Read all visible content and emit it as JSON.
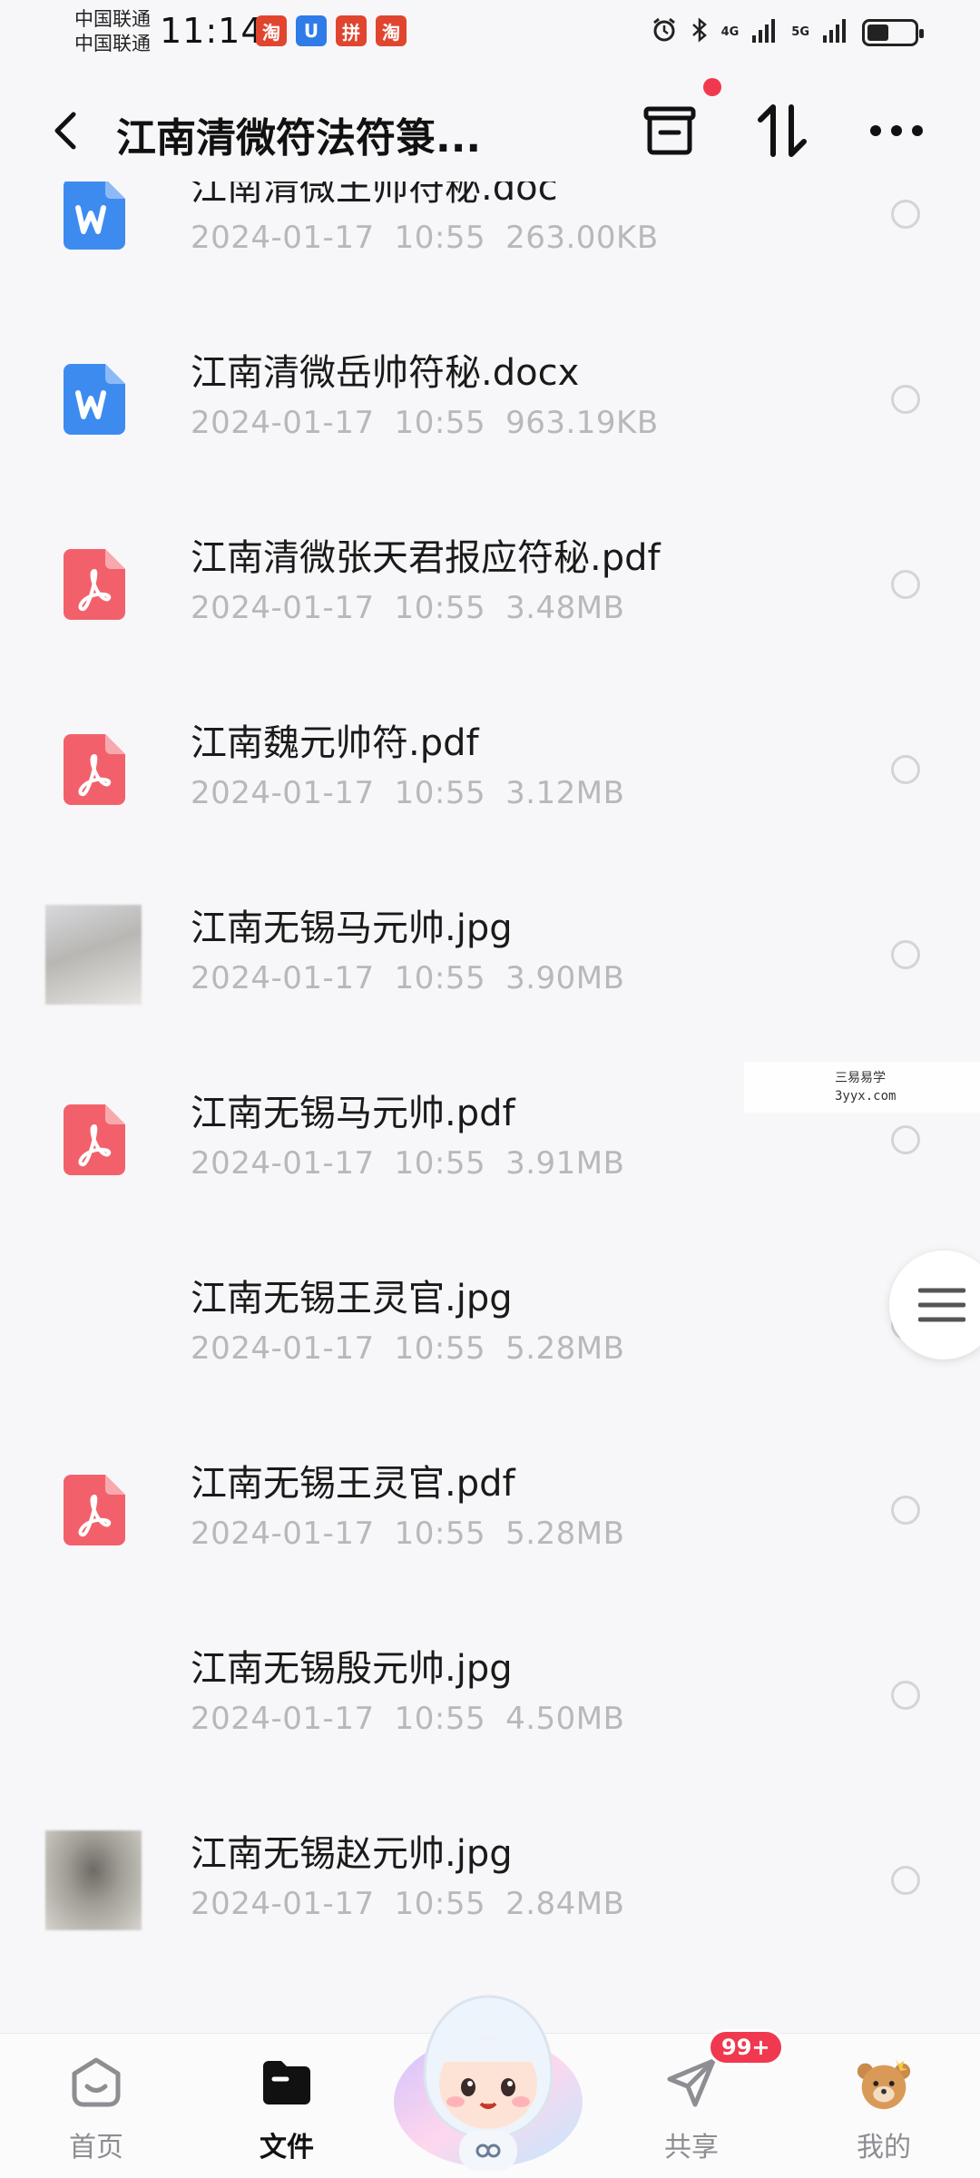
{
  "status_bar": {
    "carrier_1": "中国联通",
    "carrier_2": "中国联通",
    "time": "11:14",
    "apps": [
      "淘",
      "U",
      "拼",
      "淘"
    ],
    "network_1": "4G",
    "network_2": "5G",
    "battery_level": 0.45
  },
  "header": {
    "title": "江南清微符法符箓...",
    "icons": [
      "back-arrow-icon",
      "transfer-box-icon",
      "sort-arrows-icon",
      "more-dots-icon"
    ]
  },
  "files": [
    {
      "name": "江南清微王帅符秘.doc",
      "date": "2024-01-17",
      "time": "10:55",
      "size": "263.00KB",
      "type": "word"
    },
    {
      "name": "江南清微岳帅符秘.docx",
      "date": "2024-01-17",
      "time": "10:55",
      "size": "963.19KB",
      "type": "word"
    },
    {
      "name": "江南清微张天君报应符秘.pdf",
      "date": "2024-01-17",
      "time": "10:55",
      "size": "3.48MB",
      "type": "pdf"
    },
    {
      "name": "江南魏元帅符.pdf",
      "date": "2024-01-17",
      "time": "10:55",
      "size": "3.12MB",
      "type": "pdf"
    },
    {
      "name": "江南无锡马元帅.jpg",
      "date": "2024-01-17",
      "time": "10:55",
      "size": "3.90MB",
      "type": "image"
    },
    {
      "name": "江南无锡马元帅.pdf",
      "date": "2024-01-17",
      "time": "10:55",
      "size": "3.91MB",
      "type": "pdf"
    },
    {
      "name": "江南无锡王灵官.jpg",
      "date": "2024-01-17",
      "time": "10:55",
      "size": "5.28MB",
      "type": "image-blank"
    },
    {
      "name": "江南无锡王灵官.pdf",
      "date": "2024-01-17",
      "time": "10:55",
      "size": "5.28MB",
      "type": "pdf"
    },
    {
      "name": "江南无锡殷元帅.jpg",
      "date": "2024-01-17",
      "time": "10:55",
      "size": "4.50MB",
      "type": "image-blank"
    },
    {
      "name": "江南无锡赵元帅.jpg",
      "date": "2024-01-17",
      "time": "10:55",
      "size": "2.84MB",
      "type": "image-dark"
    }
  ],
  "watermark": {
    "line1": "三易易学",
    "line2": "3yyx.com"
  },
  "bottom_nav": {
    "home": "首页",
    "files": "文件",
    "share": "共享",
    "mine": "我的",
    "share_badge": "99+"
  },
  "colors": {
    "word_blue": "#3e8bf0",
    "pdf_red": "#f2616b",
    "badge_red": "#f0394f",
    "meta_gray": "#b8b8bc"
  }
}
